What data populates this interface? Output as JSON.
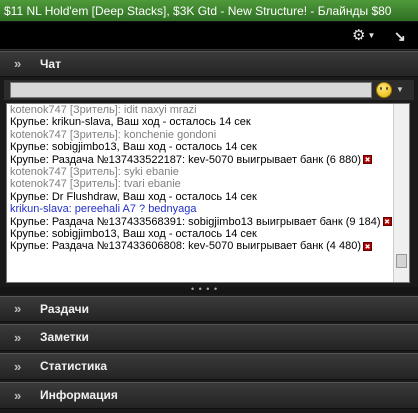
{
  "window": {
    "title": "$11 NL Hold'em [Deep Stacks], $3K Gtd - New Structure! - Блайнды $80"
  },
  "toolbar": {
    "settings_icon": "gear-icon",
    "popout_icon": "popout-arrow-icon"
  },
  "chat": {
    "title": "Чат",
    "input_value": "",
    "emoji_icon": "smiley-icon",
    "messages": [
      {
        "text": "kotenok747 [Зритель]: idit naxyi mrazi",
        "kind": "spectator"
      },
      {
        "text": "Крупье: krikun-slava, Ваш ход - осталось 14 сек",
        "kind": "dealer"
      },
      {
        "text": "kotenok747 [Зритель]: konchenie gondoni",
        "kind": "spectator"
      },
      {
        "text": "Крупье: sobigjimbo13, Ваш ход - осталось 14 сек",
        "kind": "dealer"
      },
      {
        "text": "Крупье: Раздача №137433522187: kev-5070 выигрывает банк  (6 880)",
        "kind": "dealer",
        "icon": true
      },
      {
        "text": "kotenok747 [Зритель]: syki ebanie",
        "kind": "spectator"
      },
      {
        "text": "kotenok747 [Зритель]: tvari ebanie",
        "kind": "spectator"
      },
      {
        "text": "Крупье: Dr Flushdraw, Ваш ход - осталось 14 сек",
        "kind": "dealer"
      },
      {
        "text": "krikun-slava: pereehali A7 ? bednyaga",
        "kind": "player"
      },
      {
        "text": "Крупье: Раздача №137433568391: sobigjimbo13 выигрывает банк  (9 184)",
        "kind": "dealer",
        "icon": true,
        "wrap": true
      },
      {
        "text": "Крупье: sobigjimbo13, Ваш ход - осталось 14 сек",
        "kind": "dealer"
      },
      {
        "text": "Крупье: Раздача №137433606808: kev-5070 выигрывает банк  (4 480)",
        "kind": "dealer",
        "icon": true
      }
    ]
  },
  "panels": [
    {
      "label": "Раздачи"
    },
    {
      "label": "Заметки"
    },
    {
      "label": "Статистика"
    },
    {
      "label": "Информация"
    }
  ],
  "colors": {
    "titlebar": "#3f8a30",
    "spectator_text": "#808080",
    "player_text": "#2030c8",
    "win_icon": "#b00000"
  }
}
